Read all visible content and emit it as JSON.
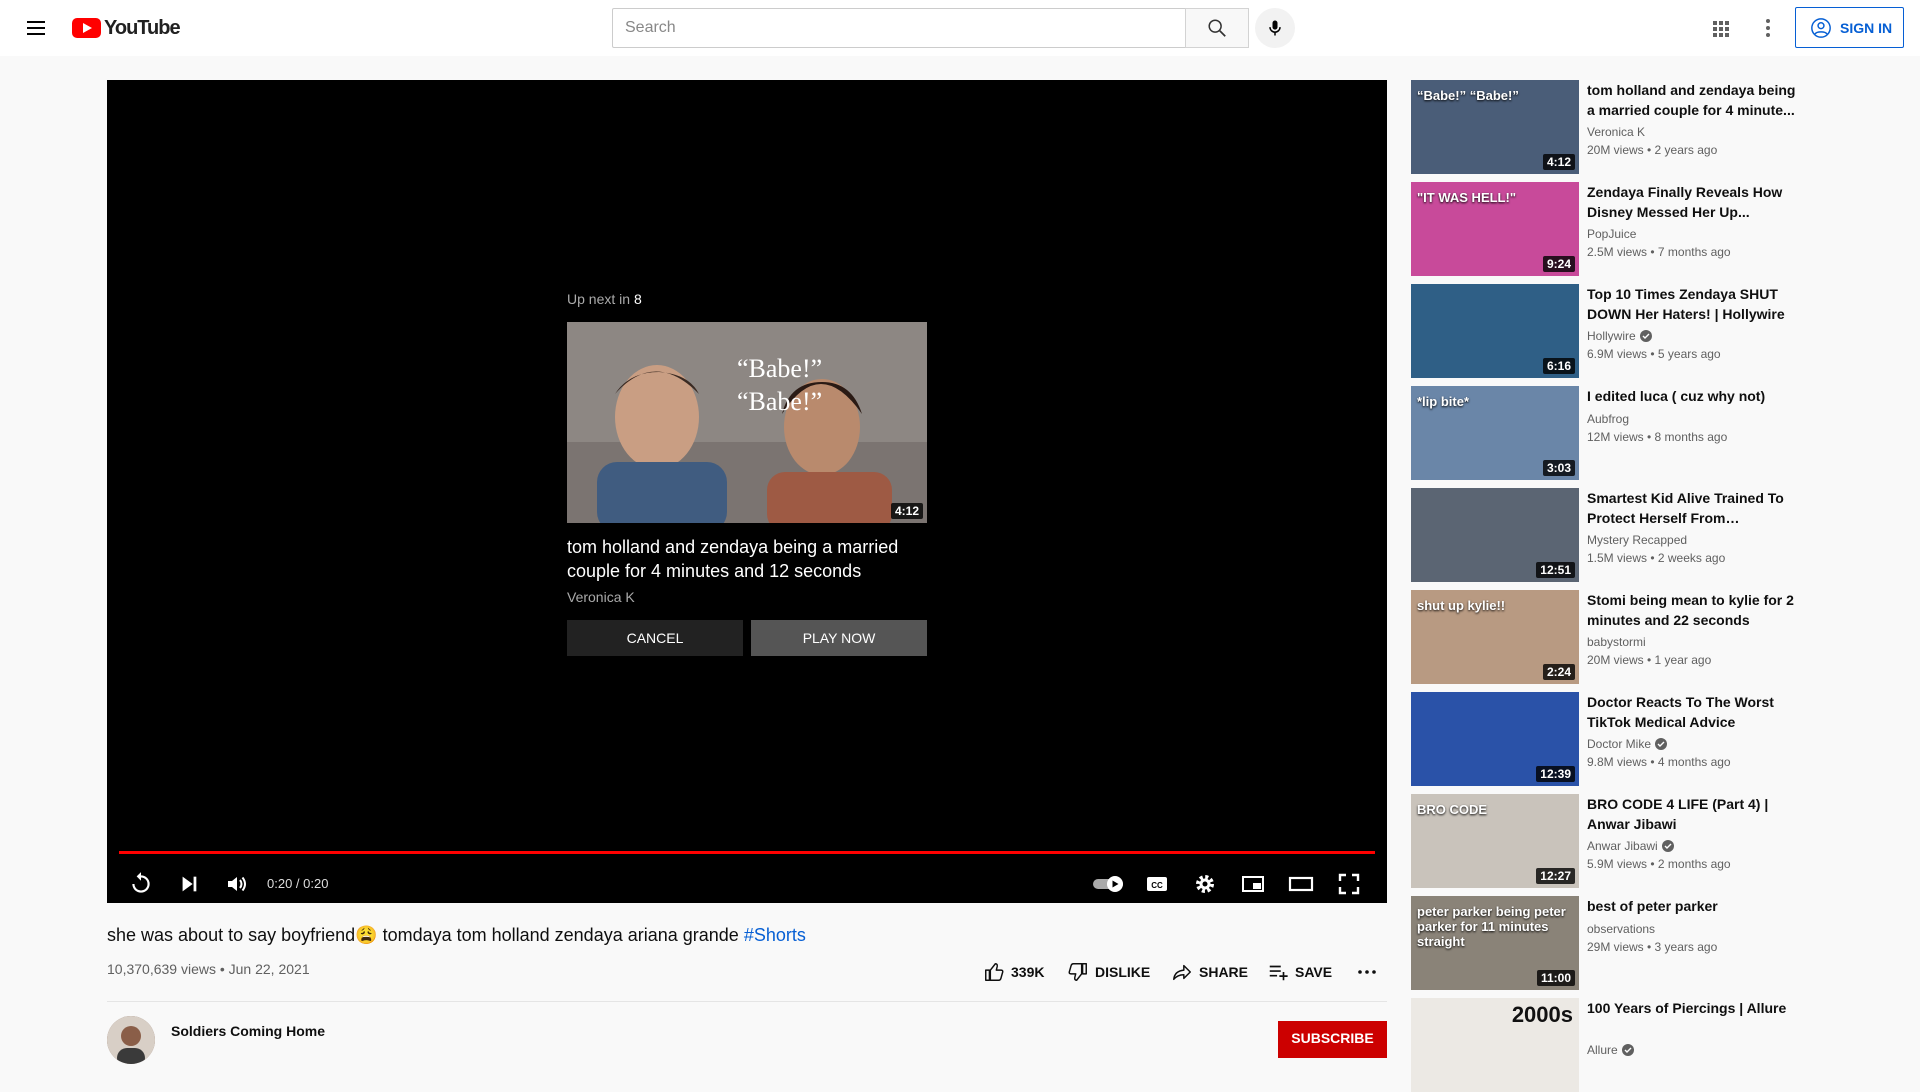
{
  "masthead": {
    "logo_text": "YouTube",
    "search_placeholder": "Search",
    "sign_in_label": "SIGN IN"
  },
  "player": {
    "up_next_label": "Up next in",
    "countdown": "8",
    "next_title": "tom holland and zendaya being a married couple for 4 minutes and 12 seconds",
    "next_channel": "Veronica K",
    "next_duration": "4:12",
    "thumb_caption_1": "“Babe!”",
    "thumb_caption_2": "“Babe!”",
    "cancel_label": "CANCEL",
    "play_now_label": "PLAY NOW",
    "time_display": "0:20 / 0:20",
    "progress_fraction": 1.0
  },
  "video": {
    "title": "she was about to say boyfriend😩 tomdaya tom holland zendaya ariana grande ",
    "hashtag": "#Shorts",
    "views_date": "10,370,639 views • Jun 22, 2021",
    "like_count": "339K",
    "dislike_label": "DISLIKE",
    "share_label": "SHARE",
    "save_label": "SAVE",
    "channel_name": "Soldiers Coming Home",
    "subscribe_label": "SUBSCRIBE"
  },
  "recommendations": [
    {
      "title": "tom holland and zendaya being a married couple for 4 minute...",
      "channel": "Veronica K",
      "verified": false,
      "meta": "20M views • 2 years ago",
      "duration": "4:12",
      "thumb_color": "#4a5d78",
      "thumb_text": "“Babe!” “Babe!”"
    },
    {
      "title": "Zendaya Finally Reveals How Disney Messed Her Up...",
      "channel": "PopJuice",
      "verified": false,
      "meta": "2.5M views • 7 months ago",
      "duration": "9:24",
      "thumb_color": "#c84a9a",
      "thumb_text": "\"IT WAS HELL!\""
    },
    {
      "title": "Top 10 Times Zendaya SHUT DOWN Her Haters! | Hollywire",
      "channel": "Hollywire",
      "verified": true,
      "meta": "6.9M views • 5 years ago",
      "duration": "6:16",
      "thumb_color": "#2f5f86",
      "thumb_text": ""
    },
    {
      "title": "I edited luca ( cuz why not)",
      "channel": "Aubfrog",
      "verified": false,
      "meta": "12M views • 8 months ago",
      "duration": "3:03",
      "thumb_color": "#6a86a8",
      "thumb_text": "*lip bite*"
    },
    {
      "title": "Smartest Kid Alive Trained To Protect Herself From Criminal...",
      "channel": "Mystery Recapped",
      "verified": false,
      "meta": "1.5M views • 2 weeks ago",
      "duration": "12:51",
      "thumb_color": "#5b6573",
      "thumb_text": ""
    },
    {
      "title": "Stomi being mean to kylie for 2 minutes and 22 seconds",
      "channel": "babystormi",
      "verified": false,
      "meta": "20M views • 1 year ago",
      "duration": "2:24",
      "thumb_color": "#b89a82",
      "thumb_text": "shut up kylie!!"
    },
    {
      "title": "Doctor Reacts To The Worst TikTok Medical Advice",
      "channel": "Doctor Mike",
      "verified": true,
      "meta": "9.8M views • 4 months ago",
      "duration": "12:39",
      "thumb_color": "#2a52a8",
      "thumb_text": ""
    },
    {
      "title": "BRO CODE 4 LIFE (Part 4) | Anwar Jibawi",
      "channel": "Anwar Jibawi",
      "verified": true,
      "meta": "5.9M views • 2 months ago",
      "duration": "12:27",
      "thumb_color": "#c9c3bb",
      "thumb_text": "BRO CODE"
    },
    {
      "title": "best of peter parker",
      "channel": "observations",
      "verified": false,
      "meta": "29M views • 3 years ago",
      "duration": "11:00",
      "thumb_color": "#8a8378",
      "thumb_text": "peter parker being peter parker for 11 minutes straight"
    },
    {
      "title": "100 Years of Piercings | Allure",
      "channel": "Allure",
      "verified": true,
      "meta": "",
      "duration": "",
      "thumb_color": "#ece9e4",
      "thumb_text": "2000s"
    }
  ]
}
